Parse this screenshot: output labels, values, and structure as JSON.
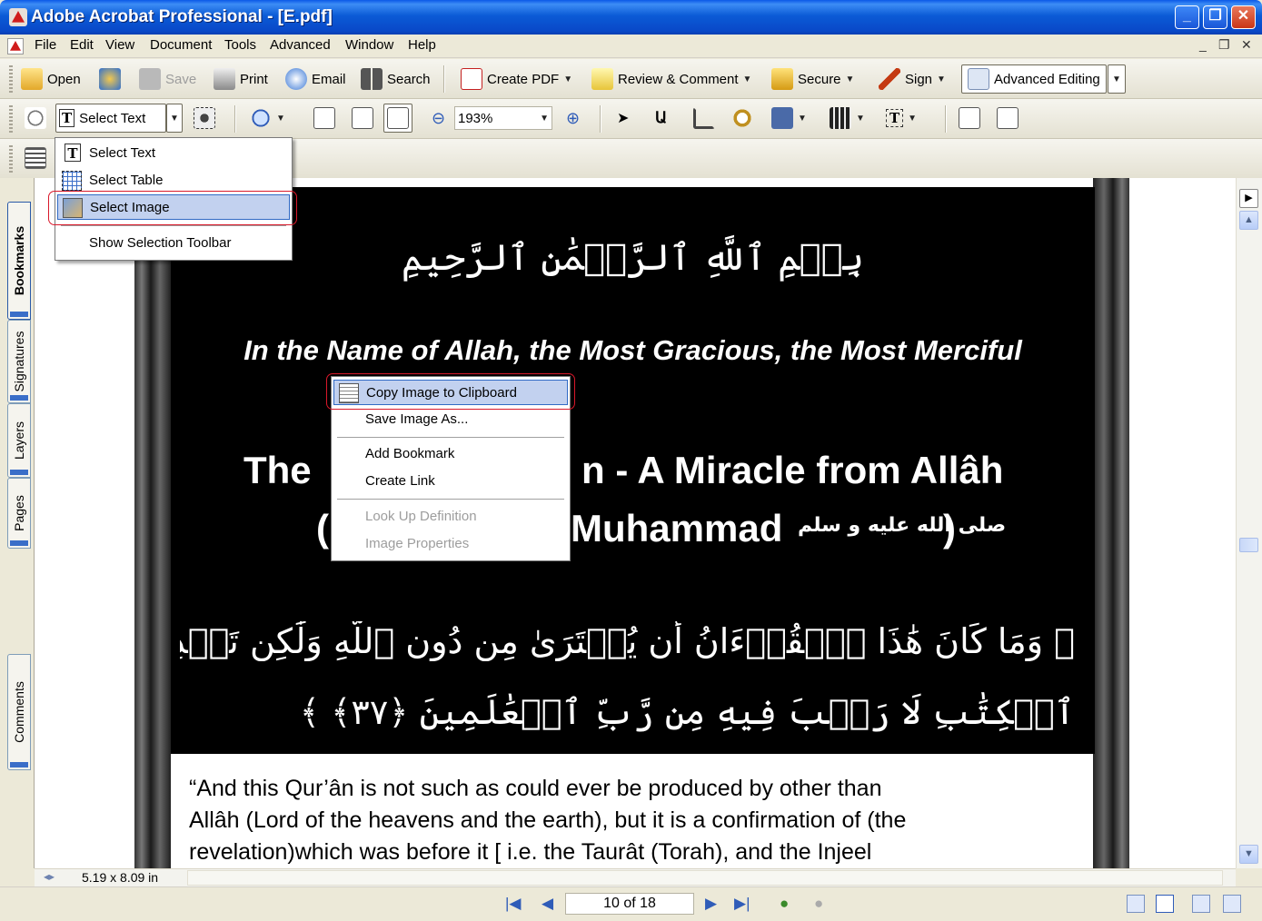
{
  "window": {
    "title": "Adobe Acrobat Professional - [E.pdf]",
    "min": "_",
    "max": "❐",
    "close": "✕"
  },
  "menubar": {
    "items": [
      "File",
      "Edit",
      "View",
      "Document",
      "Tools",
      "Advanced",
      "Window",
      "Help"
    ],
    "mdi_min": "_",
    "mdi_restore": "❐",
    "mdi_close": "✕"
  },
  "toolbar1": {
    "open": "Open",
    "save": "Save",
    "print": "Print",
    "email": "Email",
    "search": "Search",
    "create_pdf": "Create PDF",
    "review": "Review & Comment",
    "secure": "Secure",
    "sign": "Sign",
    "advanced_editing": "Advanced Editing"
  },
  "toolbar2": {
    "select_text": "Select Text",
    "zoom_value": "193%"
  },
  "select_menu": {
    "items": [
      {
        "label": "Select Text",
        "underline": "x"
      },
      {
        "label": "Select Table",
        "underline": "T"
      },
      {
        "label": "Select Image",
        "underline": "I"
      },
      {
        "label": "Show Selection Toolbar",
        "underline": "w"
      }
    ]
  },
  "context_menu": {
    "items": [
      "Copy Image to Clipboard",
      "Save Image As...",
      "Add Bookmark",
      "Create Link",
      "Look Up Definition",
      "Image Properties"
    ]
  },
  "nav_tabs": [
    "Bookmarks",
    "Signatures",
    "Layers",
    "Pages",
    "Comments"
  ],
  "document": {
    "basmala": "بِسۡمِ ٱللَّهِ ٱلرَّحۡمَٰنِ ٱلرَّحِيمِ",
    "name_line": "In the Name of Allah, the Most Gracious, the Most Merciful",
    "heading_left": "The",
    "heading_right": "n - A Miracle from Allâh",
    "sub_left": "(",
    "sub_right": "Muhammad",
    "sub_arabic": "صلى الله عليه و سلم",
    "sub_paren": ")",
    "verse_line1": "﴿ وَمَا كَانَ هَٰذَا ٱلۡقُرۡءَانُ أَن يُفۡتَرَىٰ مِن دُونِ ٱللَّهِ وَلَٰكِن تَصۡدِيقَ ٱلَّذِي بَيۡنَ يَدَيۡهِ وَتَفۡصِيلَ",
    "verse_line2": "ٱلۡكِتَٰبِ لَا رَيۡبَ فِيهِ مِن رَّبِّ ٱلۡعَٰلَمِينَ ﴿٣٧﴾ ﴾",
    "body_line1": "“And this Qur’ân is not such as could ever be produced by other than",
    "body_line2": "Allâh (Lord of the heavens and the earth), but it is a confirmation of (the",
    "body_line3": "revelation)which was before it [ i.e. the Taurât (Torah), and the Injeel"
  },
  "status": {
    "page_size": "5.19 x 8.09 in",
    "page_indicator": "10 of 18"
  }
}
